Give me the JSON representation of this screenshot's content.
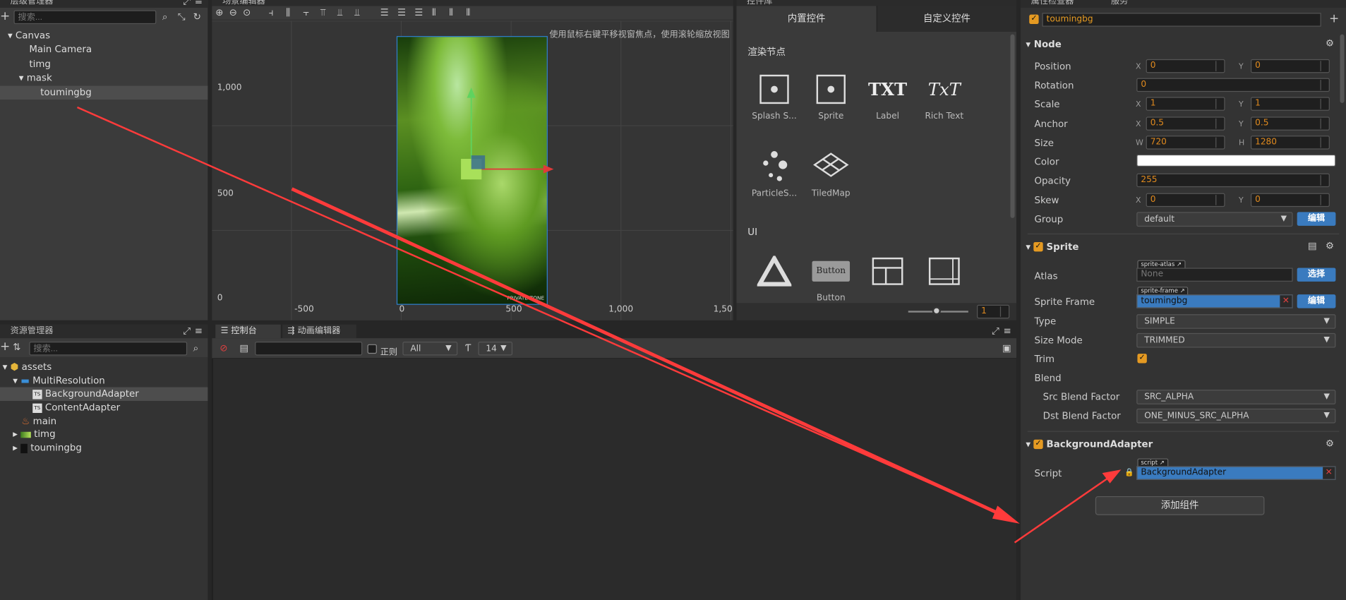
{
  "hierarchy": {
    "title": "层级管理器",
    "search_placeholder": "搜索...",
    "items": [
      {
        "label": "Canvas",
        "arrow": "▾"
      },
      {
        "label": "Main Camera",
        "arrow": ""
      },
      {
        "label": "timg",
        "arrow": ""
      },
      {
        "label": "mask",
        "arrow": "▾"
      },
      {
        "label": "toumingbg",
        "arrow": ""
      }
    ]
  },
  "scene": {
    "title": "场景编辑器",
    "hint": "使用鼠标右键平移视窗焦点，使用滚轮缩放视图",
    "y_labels": [
      "1,000",
      "500",
      "0"
    ],
    "x_labels": [
      "-500",
      "0",
      "500",
      "1,000",
      "1,50"
    ],
    "image_caption": "PRIVATE ZONE"
  },
  "library": {
    "title": "控件库",
    "tabs": [
      "内置控件",
      "自定义控件"
    ],
    "section_render": "渲染节点",
    "section_ui": "UI",
    "render_widgets": [
      "Splash S...",
      "Sprite",
      "Label",
      "Rich Text",
      "ParticleS...",
      "TiledMap"
    ],
    "ui_widgets": [
      "",
      "Button",
      "",
      ""
    ],
    "button_widget_text": "Button",
    "label_icon_text": "TXT",
    "richtext_icon_text": "TxT",
    "zoom_value": "1"
  },
  "assets": {
    "title": "资源管理器",
    "search_placeholder": "搜索...",
    "items": [
      {
        "label": "assets"
      },
      {
        "label": "MultiResolution"
      },
      {
        "label": "BackgroundAdapter"
      },
      {
        "label": "ContentAdapter"
      },
      {
        "label": "main"
      },
      {
        "label": "timg"
      },
      {
        "label": "toumingbg"
      }
    ]
  },
  "console": {
    "tab_console": "控制台",
    "tab_anim": "动画编辑器",
    "regex_label": "正则",
    "filter_value": "All",
    "font_size": "14"
  },
  "inspector": {
    "title": "属性检查器",
    "tab2": "服务",
    "node_name": "toumingbg",
    "node_section": "Node",
    "position_label": "Position",
    "position_x": "0",
    "position_y": "0",
    "rotation_label": "Rotation",
    "rotation": "0",
    "scale_label": "Scale",
    "scale_x": "1",
    "scale_y": "1",
    "anchor_label": "Anchor",
    "anchor_x": "0.5",
    "anchor_y": "0.5",
    "size_label": "Size",
    "size_w": "720",
    "size_h": "1280",
    "color_label": "Color",
    "color_value": "#ffffff",
    "opacity_label": "Opacity",
    "opacity": "255",
    "skew_label": "Skew",
    "skew_x": "0",
    "skew_y": "0",
    "group_label": "Group",
    "group": "default",
    "edit_btn": "编辑",
    "x": "X",
    "y": "Y",
    "w": "W",
    "h": "H",
    "sprite_section": "Sprite",
    "atlas_label": "Atlas",
    "atlas_badge": "sprite-atlas",
    "atlas_value": "None",
    "select_btn": "选择",
    "frame_label": "Sprite Frame",
    "frame_badge": "sprite-frame",
    "frame_value": "toumingbg",
    "type_label": "Type",
    "type_value": "SIMPLE",
    "sizemode_label": "Size Mode",
    "sizemode_value": "TRIMMED",
    "trim_label": "Trim",
    "blend_label": "Blend",
    "src_label": "Src Blend Factor",
    "src_value": "SRC_ALPHA",
    "dst_label": "Dst Blend Factor",
    "dst_value": "ONE_MINUS_SRC_ALPHA",
    "adapter_section": "BackgroundAdapter",
    "script_label": "Script",
    "script_badge": "script",
    "script_value": "BackgroundAdapter",
    "add_component": "添加组件"
  },
  "colors": {
    "accent": "#e59a22",
    "selection": "#3a7bbf",
    "arrow": "#ff3b3b"
  }
}
